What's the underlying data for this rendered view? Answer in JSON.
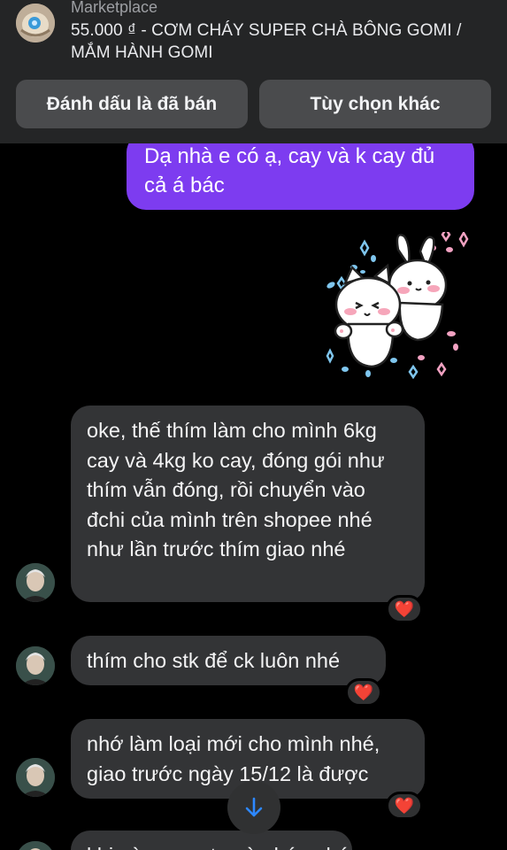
{
  "listing": {
    "source": "Marketplace",
    "title": "55.000 ₫ - CƠM CHÁY SUPER CHÀ BÔNG GOMI / MẮM HÀNH GOMI"
  },
  "actions": {
    "mark_sold": "Đánh dấu là đã bán",
    "more_options": "Tùy chọn khác"
  },
  "messages": {
    "outgoing_1": "Dạ nhà e có ạ, cay và k cay đủ cả á bác",
    "incoming_1": "oke, thế thím làm cho mình 6kg cay và 4kg ko cay, đóng gói như thím vẫn đóng, rồi chuyển vào đchi của mình trên shopee nhé như lần trước thím giao nhé",
    "incoming_2": "thím cho stk để ck luôn nhé",
    "incoming_3": "nhớ làm loại mới cho mình nhé, giao trước ngày 15/12 là được",
    "incoming_4_partial": "khi nào xong tg nào báo nhé"
  },
  "reactions": {
    "heart": "❤️"
  },
  "colors": {
    "header_bg": "#242526",
    "outgoing_bubble": "#7d3cf0",
    "incoming_bubble": "#333436",
    "accent_blue": "#2d88ff"
  },
  "icons": {
    "listing_thumb": "product-thumbnail",
    "sticker": "cat-and-bunny-sticker",
    "scroll": "arrow-down-icon"
  }
}
